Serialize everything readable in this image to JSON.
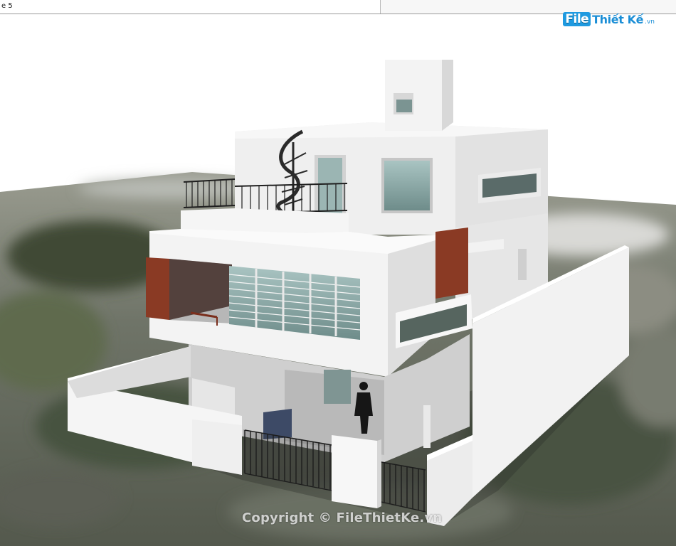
{
  "tab": {
    "label": "e 5"
  },
  "logo": {
    "mark": "File",
    "name": "Thiết Kế",
    "tld": ".vn"
  },
  "watermark": {
    "text": "Copyright © FileThietKe.vn"
  },
  "colors": {
    "logo_blue": "#1b8ed6",
    "wall": "#f2f2f2",
    "brick": "#8a3a24",
    "glass": "#8fb0ad"
  },
  "icons": {
    "logo": "filethietke-logo"
  }
}
